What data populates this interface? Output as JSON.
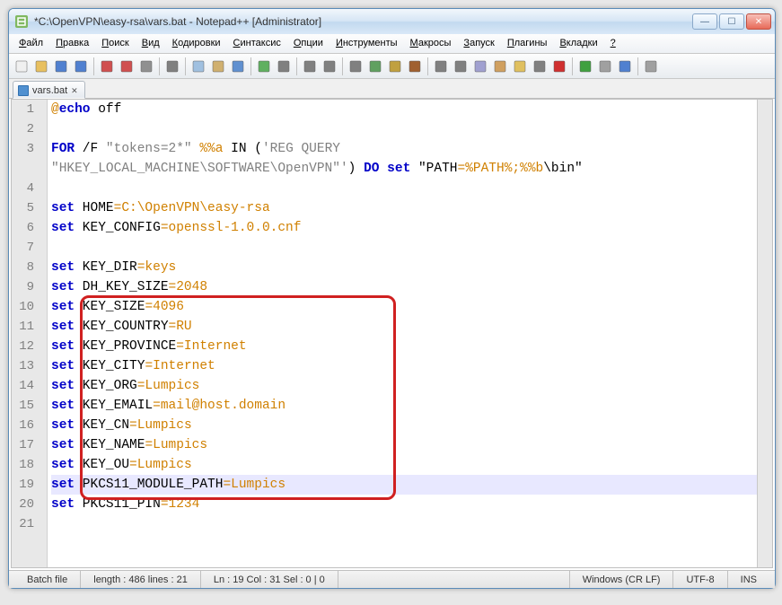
{
  "window": {
    "title": "*C:\\OpenVPN\\easy-rsa\\vars.bat - Notepad++ [Administrator]"
  },
  "menu": {
    "items": [
      "Файл",
      "Правка",
      "Поиск",
      "Вид",
      "Кодировки",
      "Синтаксис",
      "Опции",
      "Инструменты",
      "Макросы",
      "Запуск",
      "Плагины",
      "Вкладки",
      "?"
    ]
  },
  "tab": {
    "name": "vars.bat"
  },
  "lines": {
    "count": 21,
    "current": 19
  },
  "code": [
    {
      "n": 1,
      "tokens": [
        {
          "t": "@",
          "c": "var"
        },
        {
          "t": "echo",
          "c": "kw"
        },
        {
          "t": " off",
          "c": "txt"
        }
      ]
    },
    {
      "n": 2,
      "tokens": []
    },
    {
      "n": 3,
      "tokens": [
        {
          "t": "FOR",
          "c": "kw"
        },
        {
          "t": " /F ",
          "c": "txt"
        },
        {
          "t": "\"tokens=2*\"",
          "c": "str"
        },
        {
          "t": " ",
          "c": "txt"
        },
        {
          "t": "%%a",
          "c": "var"
        },
        {
          "t": " IN (",
          "c": "txt"
        },
        {
          "t": "'REG QUERY",
          "c": "str"
        }
      ]
    },
    {
      "n": 0,
      "tokens": [
        {
          "t": "\"HKEY_LOCAL_MACHINE\\SOFTWARE\\OpenVPN\"'",
          "c": "str"
        },
        {
          "t": ") ",
          "c": "txt"
        },
        {
          "t": "DO",
          "c": "kw"
        },
        {
          "t": " ",
          "c": "txt"
        },
        {
          "t": "set",
          "c": "kw"
        },
        {
          "t": " \"PATH",
          "c": "txt"
        },
        {
          "t": "=%PATH%;%%b",
          "c": "var"
        },
        {
          "t": "\\bin\"",
          "c": "txt"
        }
      ]
    },
    {
      "n": 4,
      "tokens": []
    },
    {
      "n": 5,
      "tokens": [
        {
          "t": "set",
          "c": "kw"
        },
        {
          "t": " HOME",
          "c": "txt"
        },
        {
          "t": "=C:\\OpenVPN\\easy-rsa",
          "c": "var"
        }
      ]
    },
    {
      "n": 6,
      "tokens": [
        {
          "t": "set",
          "c": "kw"
        },
        {
          "t": " KEY_CONFIG",
          "c": "txt"
        },
        {
          "t": "=openssl-1.0.0.cnf",
          "c": "var"
        }
      ]
    },
    {
      "n": 7,
      "tokens": []
    },
    {
      "n": 8,
      "tokens": [
        {
          "t": "set",
          "c": "kw"
        },
        {
          "t": " KEY_DIR",
          "c": "txt"
        },
        {
          "t": "=keys",
          "c": "var"
        }
      ]
    },
    {
      "n": 9,
      "tokens": [
        {
          "t": "set",
          "c": "kw"
        },
        {
          "t": " DH_KEY_SIZE",
          "c": "txt"
        },
        {
          "t": "=2048",
          "c": "var"
        }
      ]
    },
    {
      "n": 10,
      "tokens": [
        {
          "t": "set",
          "c": "kw"
        },
        {
          "t": " KEY_SIZE",
          "c": "txt"
        },
        {
          "t": "=4096",
          "c": "var"
        }
      ]
    },
    {
      "n": 11,
      "tokens": [
        {
          "t": "set",
          "c": "kw"
        },
        {
          "t": " KEY_COUNTRY",
          "c": "txt"
        },
        {
          "t": "=RU",
          "c": "var"
        }
      ]
    },
    {
      "n": 12,
      "tokens": [
        {
          "t": "set",
          "c": "kw"
        },
        {
          "t": " KEY_PROVINCE",
          "c": "txt"
        },
        {
          "t": "=Internet",
          "c": "var"
        }
      ]
    },
    {
      "n": 13,
      "tokens": [
        {
          "t": "set",
          "c": "kw"
        },
        {
          "t": " KEY_CITY",
          "c": "txt"
        },
        {
          "t": "=Internet",
          "c": "var"
        }
      ]
    },
    {
      "n": 14,
      "tokens": [
        {
          "t": "set",
          "c": "kw"
        },
        {
          "t": " KEY_ORG",
          "c": "txt"
        },
        {
          "t": "=Lumpics",
          "c": "var"
        }
      ]
    },
    {
      "n": 15,
      "tokens": [
        {
          "t": "set",
          "c": "kw"
        },
        {
          "t": " KEY_EMAIL",
          "c": "txt"
        },
        {
          "t": "=mail@host.domain",
          "c": "var"
        }
      ]
    },
    {
      "n": 16,
      "tokens": [
        {
          "t": "set",
          "c": "kw"
        },
        {
          "t": " KEY_CN",
          "c": "txt"
        },
        {
          "t": "=Lumpics",
          "c": "var"
        }
      ]
    },
    {
      "n": 17,
      "tokens": [
        {
          "t": "set",
          "c": "kw"
        },
        {
          "t": " KEY_NAME",
          "c": "txt"
        },
        {
          "t": "=Lumpics",
          "c": "var"
        }
      ]
    },
    {
      "n": 18,
      "tokens": [
        {
          "t": "set",
          "c": "kw"
        },
        {
          "t": " KEY_OU",
          "c": "txt"
        },
        {
          "t": "=Lumpics",
          "c": "var"
        }
      ]
    },
    {
      "n": 19,
      "tokens": [
        {
          "t": "set",
          "c": "kw"
        },
        {
          "t": " PKCS11_MODULE_PATH",
          "c": "txt"
        },
        {
          "t": "=Lumpics",
          "c": "var"
        }
      ]
    },
    {
      "n": 20,
      "tokens": [
        {
          "t": "set",
          "c": "kw"
        },
        {
          "t": " PKCS11_PIN",
          "c": "txt"
        },
        {
          "t": "=1234",
          "c": "var"
        }
      ]
    },
    {
      "n": 21,
      "tokens": []
    }
  ],
  "statusbar": {
    "filetype": "Batch file",
    "length": "length : 486    lines : 21",
    "position": "Ln : 19    Col : 31    Sel : 0 | 0",
    "eol": "Windows (CR LF)",
    "encoding": "UTF-8",
    "mode": "INS"
  },
  "toolbar_icons": [
    "new",
    "open",
    "save",
    "save-all",
    "close",
    "close-all",
    "print",
    "cut",
    "copy",
    "paste",
    "undo",
    "redo",
    "find",
    "replace",
    "zoom-in",
    "zoom-out",
    "sync",
    "word-wrap",
    "show-all",
    "indent-guide",
    "lang",
    "doc-map",
    "func-list",
    "folder",
    "monitor",
    "record",
    "play",
    "play-mult",
    "macro",
    "arrow"
  ]
}
